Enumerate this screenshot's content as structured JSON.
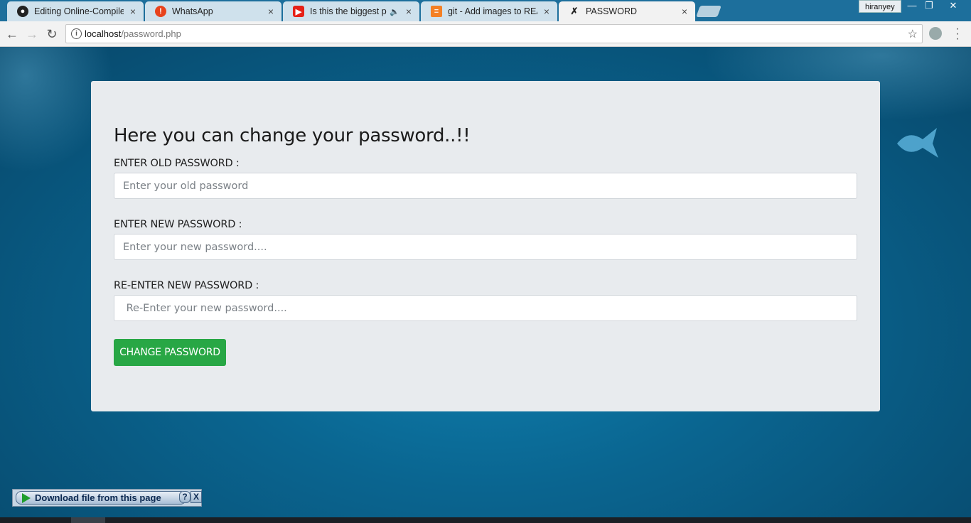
{
  "browser": {
    "tabs": [
      {
        "title": "Editing Online-Compiler/",
        "icon": "github-icon"
      },
      {
        "title": "WhatsApp",
        "icon": "whatsapp-icon"
      },
      {
        "title": "Is this the biggest pro",
        "icon": "youtube-icon",
        "audio": "🔈"
      },
      {
        "title": "git - Add images to READ",
        "icon": "stackoverflow-icon"
      },
      {
        "title": "PASSWORD",
        "icon": "page-icon"
      }
    ],
    "profile": "hiranyey",
    "window_controls": {
      "minimize": "—",
      "restore": "❐",
      "close": "✕"
    },
    "url_host": "localhost",
    "url_path": "/password.php"
  },
  "form": {
    "heading": "Here you can change your password..!!",
    "old_label": "ENTER OLD PASSWORD :",
    "old_placeholder": "Enter your old password",
    "new_label": "ENTER NEW PASSWORD :",
    "new_placeholder": "Enter your new password....",
    "confirm_label": "RE-ENTER NEW PASSWORD :",
    "confirm_placeholder": " Re-Enter your new password....",
    "submit_label": "CHANGE PASSWORD"
  },
  "download_bar": {
    "label": "Download file from this page",
    "help": "?",
    "close": "X"
  },
  "colors": {
    "accent_button": "#28a745",
    "card_bg": "#e8ebee",
    "page_bg": "#0a6590"
  }
}
